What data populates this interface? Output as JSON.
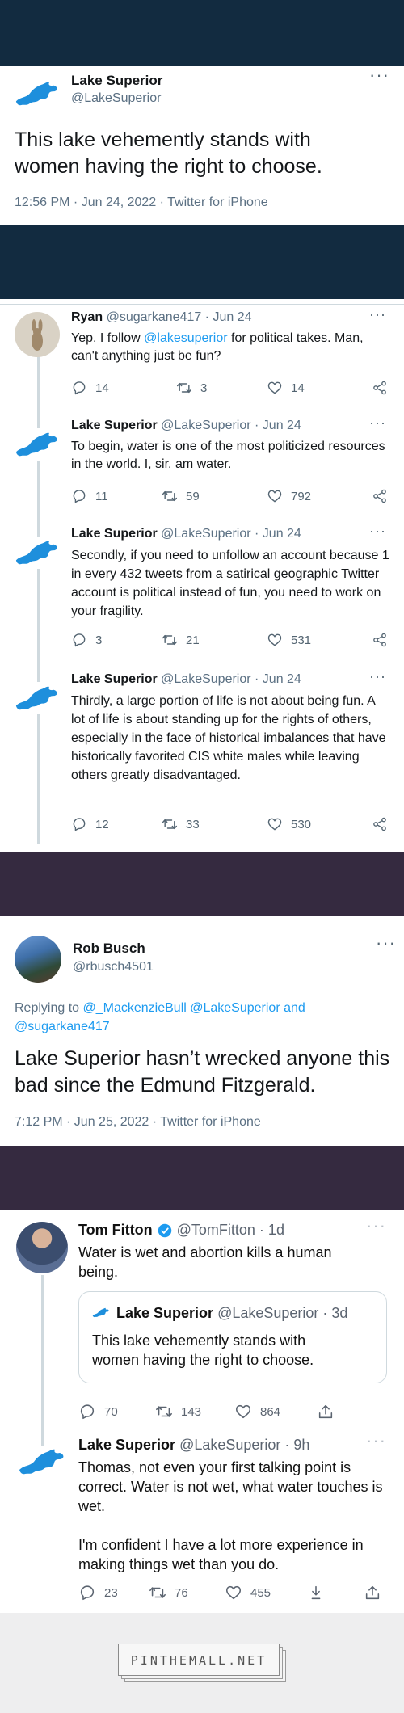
{
  "tweet1": {
    "name": "Lake Superior",
    "handle": "@LakeSuperior",
    "text": "This lake vehemently stands with women having the right to choose.",
    "meta": "12:56 PM · Jun 24, 2022 · Twitter for iPhone"
  },
  "thread": [
    {
      "name": "Ryan",
      "handle": "@sugarkane417 · Jun 24",
      "text_pre": "Yep, I follow ",
      "text_link": "@lakesuperior",
      "text_post": " for political takes.  Man, can't anything just be fun?",
      "replies": "14",
      "retweets": "3",
      "likes": "14"
    },
    {
      "name": "Lake Superior",
      "handle": "@LakeSuperior · Jun 24",
      "text": "To begin, water is one of the most politicized resources in the world. I, sir, am water.",
      "replies": "11",
      "retweets": "59",
      "likes": "792"
    },
    {
      "name": "Lake Superior",
      "handle": "@LakeSuperior · Jun 24",
      "text": "Secondly, if you need to unfollow an account because 1 in every 432 tweets from a satirical geographic Twitter account is political instead of fun, you need to work on your fragility.",
      "replies": "3",
      "retweets": "21",
      "likes": "531"
    },
    {
      "name": "Lake Superior",
      "handle": "@LakeSuperior · Jun 24",
      "text": "Thirdly, a large portion of life is not about being fun. A lot of life is about standing up for the rights of others, especially in the face of historical imbalances that have historically favorited CIS white males while leaving others greatly disadvantaged.",
      "replies": "12",
      "retweets": "33",
      "likes": "530"
    }
  ],
  "tweet_rob": {
    "name": "Rob Busch",
    "handle": "@rbusch4501",
    "replying_prefix": "Replying to ",
    "replying_links": "@_MackenzieBull @LakeSuperior and @sugarkane417",
    "text": "Lake Superior hasn’t wrecked anyone this bad since the Edmund Fitzgerald.",
    "meta": "7:12 PM · Jun 25, 2022 · Twitter for iPhone"
  },
  "tweet_tom": {
    "name": "Tom Fitton",
    "handle": "@TomFitton · 1d",
    "text": "Water is wet and abortion kills a human being.",
    "quote_name": "Lake Superior",
    "quote_handle": "@LakeSuperior · 3d",
    "quote_text": "This lake vehemently stands with women having the right to choose.",
    "replies": "70",
    "retweets": "143",
    "likes": "864"
  },
  "tweet_reply": {
    "name": "Lake Superior",
    "handle": "@LakeSuperior · 9h",
    "text1": "Thomas, not even your first talking point is correct. Water is not wet, what water touches is wet.",
    "text2": "I'm confident I have a lot more experience in making things wet than you do.",
    "replies": "23",
    "retweets": "76",
    "likes": "455"
  },
  "watermark": "PINTHEMALL.NET",
  "colors": {
    "navy": "#122b40",
    "plum": "#352a40",
    "link": "#1d9bf0",
    "lake_blue": "#1e8fdc",
    "verified": "#1d9bf0"
  },
  "icons": [
    "more-icon",
    "reply-icon",
    "retweet-icon",
    "like-icon",
    "share-icon",
    "upload-icon",
    "download-icon",
    "verified-icon",
    "lake-avatar-icon"
  ]
}
